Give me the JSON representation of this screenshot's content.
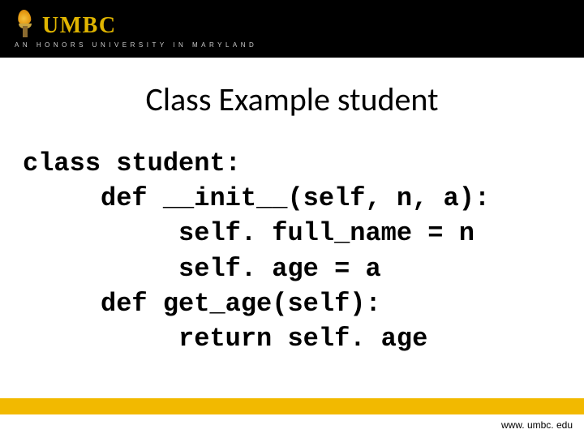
{
  "header": {
    "logo_text": "UMBC",
    "tagline": "AN HONORS UNIVERSITY IN MARYLAND"
  },
  "title": "Class Example student",
  "code": {
    "line1": "class student:",
    "line2": "     def __init__(self, n, a):",
    "line3": "          self. full_name = n",
    "line4": "          self. age = a",
    "line5": "     def get_age(self):",
    "line6": "          return self. age"
  },
  "footer": {
    "url": "www. umbc. edu"
  }
}
